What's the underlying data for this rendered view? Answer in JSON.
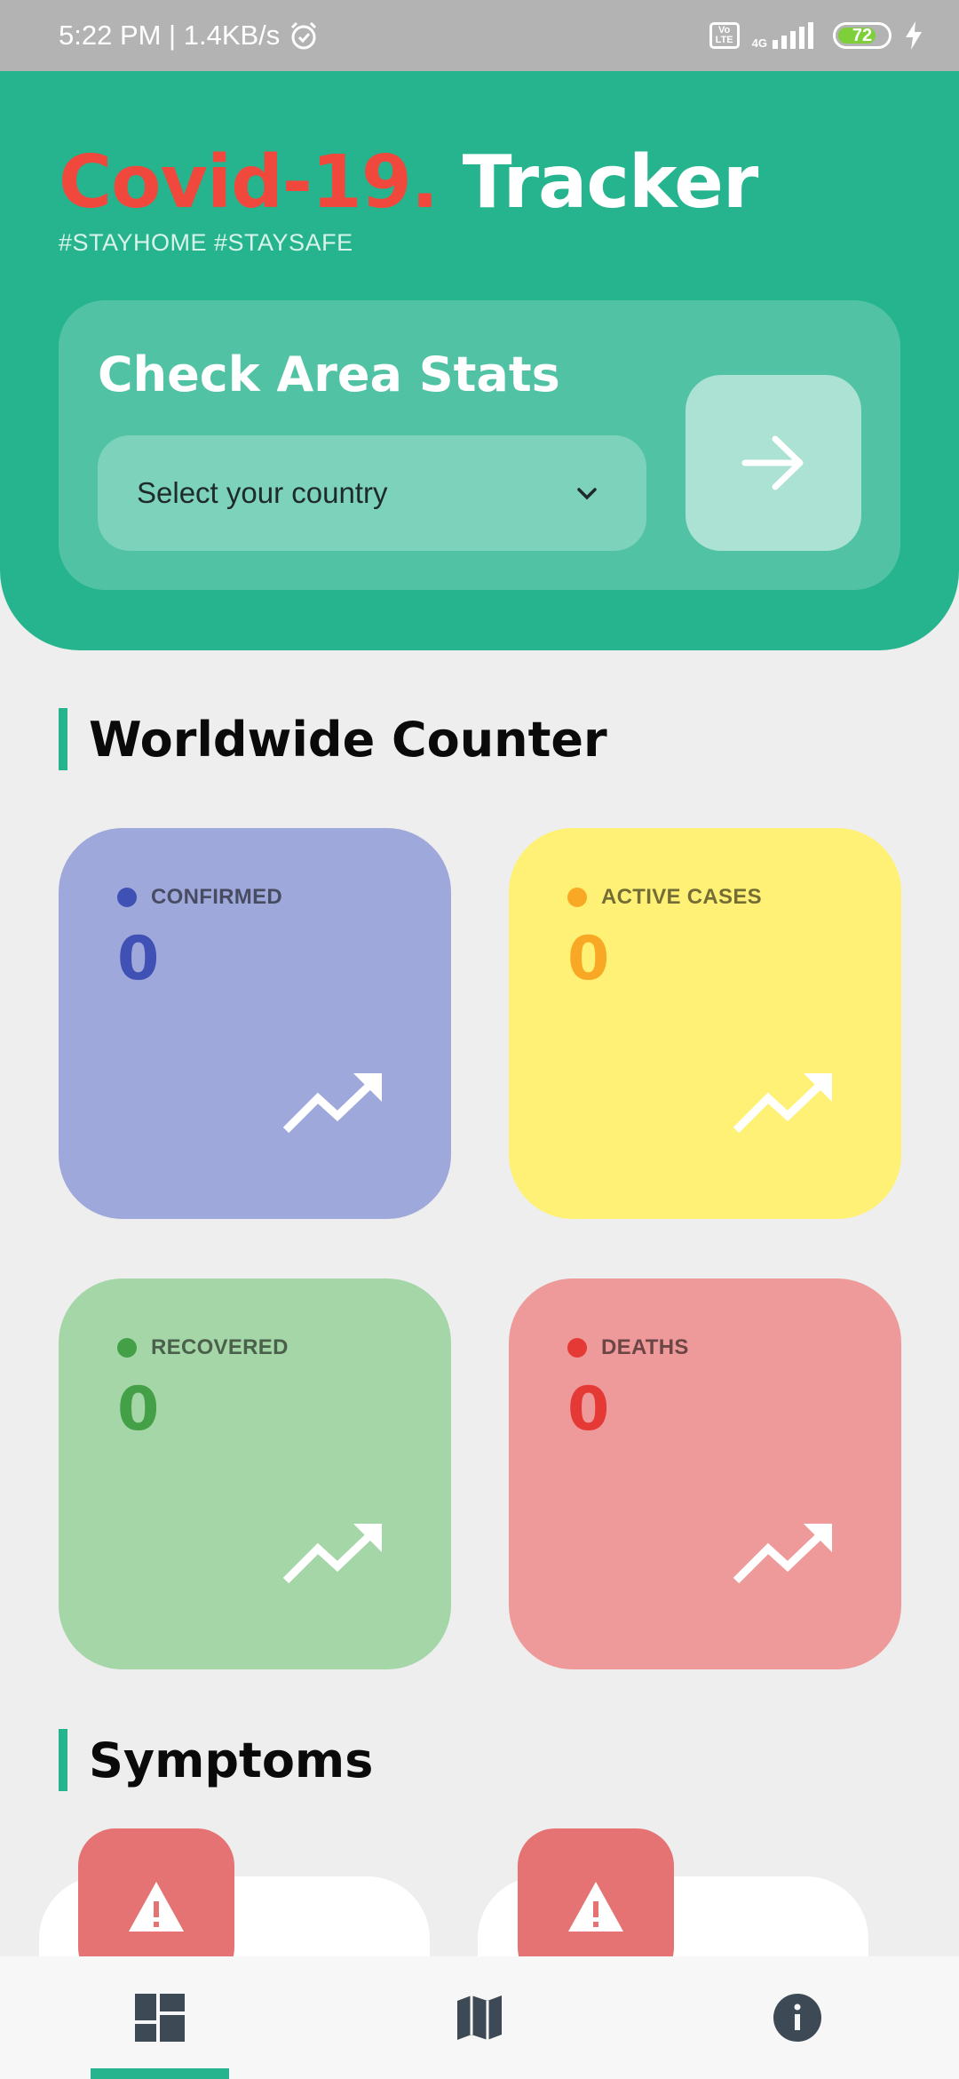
{
  "status_bar": {
    "time_speed": "5:22 PM | 1.4KB/s",
    "volte": "Vo LTE",
    "network": "4G",
    "battery": "72"
  },
  "header": {
    "title_part1": "Covid-19",
    "title_dot": ".",
    "title_part2": "Tracker",
    "hashtags": "#STAYHOME #STAYSAFE"
  },
  "area": {
    "title": "Check Area Stats",
    "select_placeholder": "Select your country"
  },
  "worldwide": {
    "title": "Worldwide Counter",
    "cards": [
      {
        "label": "CONFIRMED",
        "value": "0",
        "bg": "#9fa8da",
        "accent": "#3f51b5"
      },
      {
        "label": "ACTIVE CASES",
        "value": "0",
        "bg": "#fff176",
        "accent": "#f9a825"
      },
      {
        "label": "RECOVERED",
        "value": "0",
        "bg": "#a5d6a7",
        "accent": "#43a047"
      },
      {
        "label": "DEATHS",
        "value": "0",
        "bg": "#ef9a9a",
        "accent": "#e53935"
      }
    ]
  },
  "symptoms": {
    "title": "Symptoms"
  },
  "bottom_nav": {
    "items": [
      "dashboard-icon",
      "map-icon",
      "info-icon"
    ],
    "active": "dashboard-icon"
  },
  "colors": {
    "primary": "#26b48e",
    "title_red": "#f0483c",
    "warning_badge": "#e57373",
    "nav_icon": "#3d4a55"
  }
}
